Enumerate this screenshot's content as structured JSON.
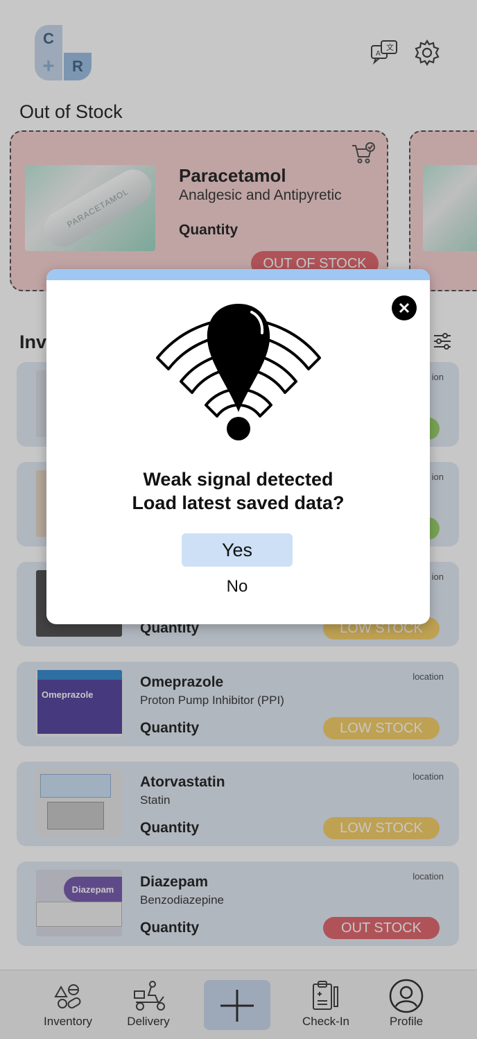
{
  "header": {
    "logo_letters": [
      "C",
      "+",
      "R"
    ],
    "icons": [
      "translate-icon",
      "gear-icon"
    ]
  },
  "out_of_stock": {
    "title": "Out of Stock",
    "item": {
      "name": "Paracetamol",
      "category": "Analgesic and Antipyretic",
      "quantity_label": "Quantity",
      "badge": "OUT OF STOCK",
      "image_text": "PARACETAMOL"
    }
  },
  "inventory": {
    "title": "Inv",
    "items": [
      {
        "name": "",
        "category": "",
        "quantity_label": "",
        "location": "ion",
        "badge": ""
      },
      {
        "name": "",
        "category": "",
        "quantity_label": "",
        "location": "ion",
        "badge": ""
      },
      {
        "name": "",
        "category": "",
        "quantity_label": "Quantity",
        "location": "ion",
        "badge": "LOW STOCK"
      },
      {
        "name": "Omeprazole",
        "category": "Proton Pump Inhibitor (PPI)",
        "quantity_label": "Quantity",
        "location": "location",
        "badge": "LOW STOCK",
        "image_text": "Omeprazole"
      },
      {
        "name": "Atorvastatin",
        "category": "Statin",
        "quantity_label": "Quantity",
        "location": "location",
        "badge": "LOW STOCK"
      },
      {
        "name": "Diazepam",
        "category": "Benzodiazepine",
        "quantity_label": "Quantity",
        "location": "location",
        "badge": "OUT STOCK",
        "image_text": "Diazepam"
      }
    ]
  },
  "bottom_nav": {
    "items": [
      {
        "label": "Inventory",
        "icon": "pills-icon"
      },
      {
        "label": "Delivery",
        "icon": "scooter-icon"
      },
      {
        "label": "",
        "icon": "plus-icon"
      },
      {
        "label": "Check-In",
        "icon": "clipboard-icon"
      },
      {
        "label": "Profile",
        "icon": "profile-icon"
      }
    ]
  },
  "modal": {
    "line1": "Weak signal detected",
    "line2": "Load latest saved data?",
    "yes_label": "Yes",
    "no_label": "No",
    "icon": "weak-signal-warning-icon"
  },
  "colors": {
    "out_badge": "#e06b73",
    "low_badge": "#f5cf6b",
    "card_bg": "#e3ebf5",
    "oos_card_bg": "#f6d2d3",
    "modal_bar": "#9fc7f2",
    "yes_button": "#cde0f5"
  }
}
